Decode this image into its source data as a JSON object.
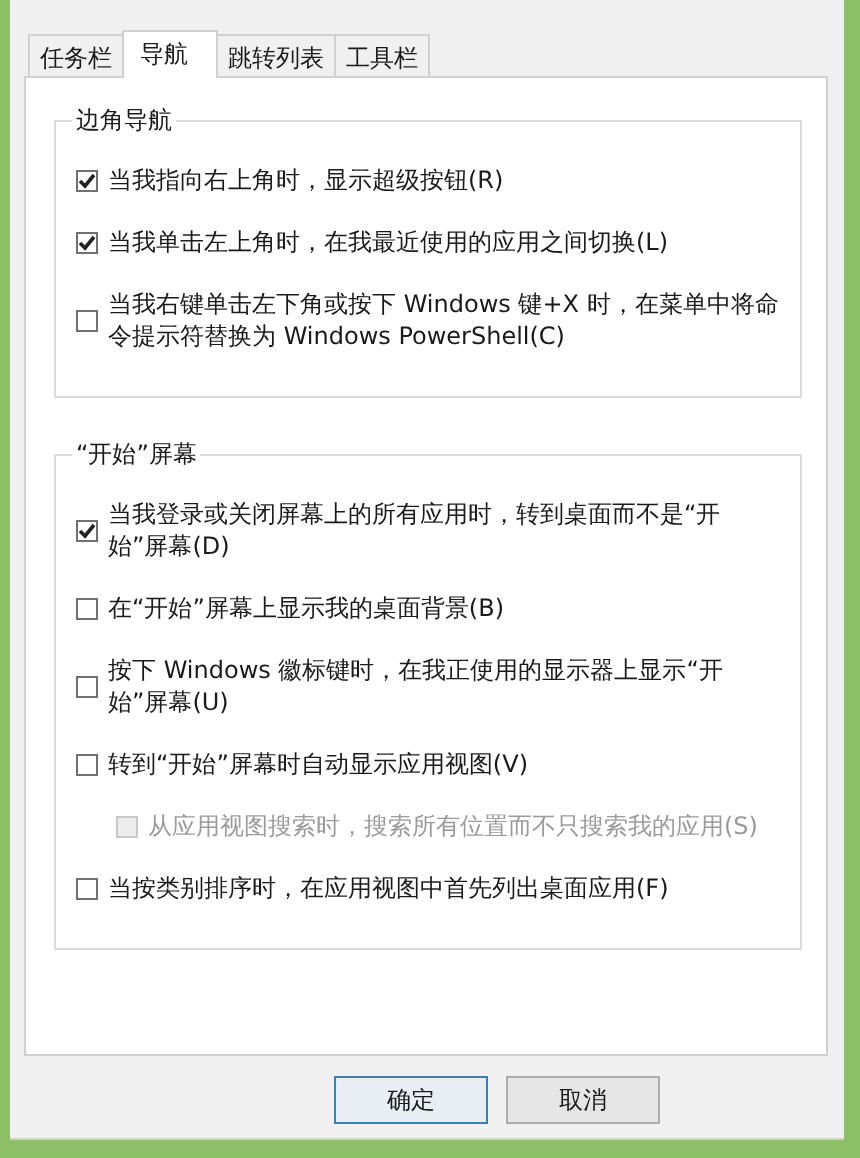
{
  "tabs": [
    {
      "label": "任务栏",
      "selected": false
    },
    {
      "label": "导航",
      "selected": true
    },
    {
      "label": "跳转列表",
      "selected": false
    },
    {
      "label": "工具栏",
      "selected": false
    }
  ],
  "groups": [
    {
      "title": "边角导航",
      "options": [
        {
          "label": "当我指向右上角时，显示超级按钮(R)",
          "checked": true,
          "disabled": false
        },
        {
          "label": "当我单击左上角时，在我最近使用的应用之间切换(L)",
          "checked": true,
          "disabled": false
        },
        {
          "label": "当我右键单击左下角或按下 Windows 键+X 时，在菜单中将命令提示符替换为 Windows PowerShell(C)",
          "checked": false,
          "disabled": false
        }
      ]
    },
    {
      "title": "“开始”屏幕",
      "options": [
        {
          "label": "当我登录或关闭屏幕上的所有应用时，转到桌面而不是“开始”屏幕(D)",
          "checked": true,
          "disabled": false
        },
        {
          "label": "在“开始”屏幕上显示我的桌面背景(B)",
          "checked": false,
          "disabled": false
        },
        {
          "label": "按下 Windows 徽标键时，在我正使用的显示器上显示“开始”屏幕(U)",
          "checked": false,
          "disabled": false
        },
        {
          "label": "转到“开始”屏幕时自动显示应用视图(V)",
          "checked": false,
          "disabled": false,
          "children": [
            {
              "label": "从应用视图搜索时，搜索所有位置而不只搜索我的应用(S)",
              "checked": false,
              "disabled": true
            }
          ]
        },
        {
          "label": "当按类别排序时，在应用视图中首先列出桌面应用(F)",
          "checked": false,
          "disabled": false
        }
      ]
    }
  ],
  "buttons": [
    {
      "label": "确定",
      "default": true
    },
    {
      "label": "取消",
      "default": false
    }
  ]
}
